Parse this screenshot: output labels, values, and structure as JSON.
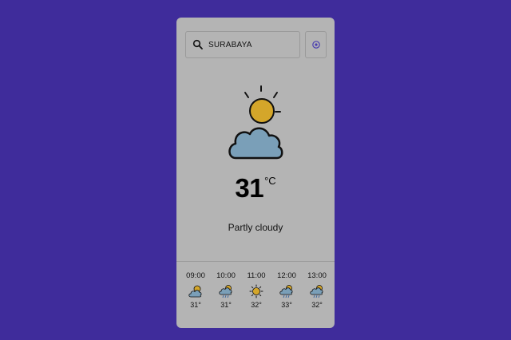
{
  "search": {
    "value": "SURABAYA",
    "icon": "search-icon"
  },
  "locate_button": {
    "icon": "location-icon"
  },
  "current": {
    "icon": "partly-cloudy-icon",
    "temperature": "31",
    "unit": "°C",
    "condition": "Partly cloudy"
  },
  "hourly": [
    {
      "time": "09:00",
      "icon": "partly-cloudy-icon",
      "temp": "31°"
    },
    {
      "time": "10:00",
      "icon": "rain-icon",
      "temp": "31°"
    },
    {
      "time": "11:00",
      "icon": "sun-icon",
      "temp": "32°"
    },
    {
      "time": "12:00",
      "icon": "rain-icon",
      "temp": "33°"
    },
    {
      "time": "13:00",
      "icon": "rain-icon",
      "temp": "32°"
    }
  ],
  "colors": {
    "background": "#3f2c9b",
    "card": "#b4b4b4",
    "sun": "#d4a62a",
    "cloud": "#7a9fb8"
  }
}
